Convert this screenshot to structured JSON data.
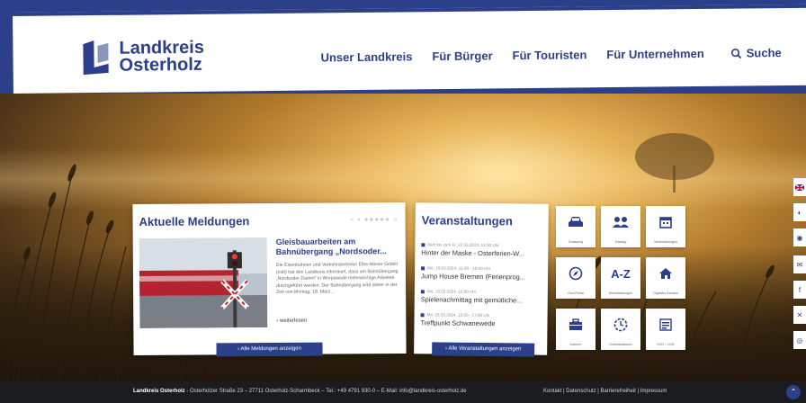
{
  "header": {
    "logo_line1": "Landkreis",
    "logo_line2": "Osterholz",
    "nav": [
      "Unser Landkreis",
      "Für Bürger",
      "Für Touristen",
      "Für Unternehmen"
    ],
    "search_label": "Suche"
  },
  "news": {
    "title": "Aktuelle Meldungen",
    "headline": "Gleisbauarbeiten am Bahnübergang „Nordsoder...",
    "body": "Die Eisenbahnen und Verkehrsbetriebe Elbe-Weser GmbH (evb) hat den Landkreis informiert, dass am Bahnübergang „Nordsoder Damm\" in Worpswede mehrwöchige Arbeiten durchgeführt werden. Der Bahnübergang wird daher in der Zeit von Montag, 18. März...",
    "more": "weiterlesen",
    "cta": "Alle Meldungen anzeigen"
  },
  "events": {
    "title": "Veranstaltungen",
    "items": [
      {
        "meta": "läuft bis zum Fr, 22.03.2024, 14:00 Uhr",
        "title": "Hinter der Maske - Osterferien-W..."
      },
      {
        "meta": "Mo, 18.03.2024, 12:00 - 18:00 Uhr",
        "title": "Jump House Bremen (Ferienprog..."
      },
      {
        "meta": "Mo, 18.03.2024, 15:00 Uhr",
        "title": "Spielenachmittag mit gemütliche..."
      },
      {
        "meta": "Mo, 18.03.2024, 15:00 - 17:00 Uhr",
        "title": "Treffpunkt Schwanewede"
      }
    ],
    "cta": "Alle Veranstaltungen anzeigen"
  },
  "tiles": [
    {
      "label": "Zulassung",
      "icon": "car-icon"
    },
    {
      "label": "Kitaslag",
      "icon": "people-icon"
    },
    {
      "label": "Veranstaltungen",
      "icon": "calendar-icon"
    },
    {
      "label": "Geo-Portal",
      "icon": "compass-icon"
    },
    {
      "label": "Dienstleistungen",
      "icon": "a-z-icon"
    },
    {
      "label": "Digitales Bauamt",
      "icon": "house-icon"
    },
    {
      "label": "Karriere",
      "icon": "briefcase-icon"
    },
    {
      "label": "Onlinetiralassen",
      "icon": "clock-icon"
    },
    {
      "label": "GVO + LIVE",
      "icon": "document-icon"
    }
  ],
  "tile_az": "A-Z",
  "news_dots": "« ▪ ●●●●● »",
  "footer": {
    "org": "Landkreis Osterholz",
    "address": " - Osterholzer Straße 23 – 27711 Osterholz-Scharmbeck – Tel.: +49 4791 930-0 – E-Mail: info@landkreis-osterholz.de",
    "links": "Kontakt | Datenschutz | Barrierefreiheit | Impressum"
  },
  "colors": {
    "brand": "#2c3f8a",
    "footer": "#1b1c20"
  }
}
